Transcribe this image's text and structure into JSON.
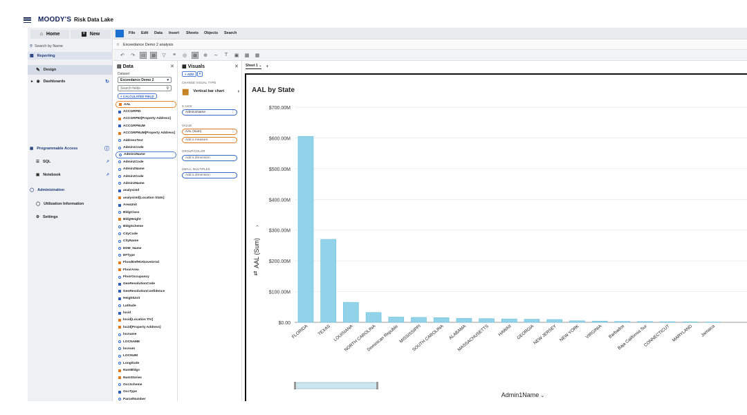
{
  "header": {
    "brand": "MOODY'S",
    "product": "Risk Data Lake"
  },
  "leftnav": {
    "home_label": "Home",
    "new_label": "New",
    "search_placeholder": "Search by Name",
    "reporting_label": "Reporting",
    "design_label": "Design",
    "dashboards_label": "Dashboards",
    "programmable_label": "Programmable Access",
    "sql_label": "SQL",
    "notebook_label": "Notebook",
    "administration_label": "Administration",
    "utilization_label": "Utilization Information",
    "settings_label": "Settings"
  },
  "appmenu": {
    "items": [
      "File",
      "Edit",
      "Data",
      "Insert",
      "Sheets",
      "Objects",
      "Search"
    ]
  },
  "analysis": {
    "name": "Exceedance Demo 2 analysis"
  },
  "datapanel": {
    "title": "Data",
    "dataset_label": "Dataset",
    "dataset_value": "Exceedance Demo 2",
    "search_placeholder": "Search fields",
    "calc_field_label": "+ CALCULATED FIELD",
    "fields": [
      {
        "name": "AAL",
        "kind": "measure",
        "selected": "orange"
      },
      {
        "name": "ACCGRPID",
        "kind": "num"
      },
      {
        "name": "ACCGRPID[Property Address]",
        "kind": "measure"
      },
      {
        "name": "ACCGRPNUM",
        "kind": "num"
      },
      {
        "name": "ACCGRPNUM[Property Address]",
        "kind": "measure"
      },
      {
        "name": "AddressText",
        "kind": "dim"
      },
      {
        "name": "Admin1Code",
        "kind": "dim"
      },
      {
        "name": "Admin1Name",
        "kind": "dim",
        "selected": "blue"
      },
      {
        "name": "Admin2Code",
        "kind": "dim"
      },
      {
        "name": "Admin2Name",
        "kind": "dim"
      },
      {
        "name": "Admin3Code",
        "kind": "dim"
      },
      {
        "name": "Admin3Name",
        "kind": "dim"
      },
      {
        "name": "analysisId",
        "kind": "num"
      },
      {
        "name": "analysisId[Location Stats]",
        "kind": "measure"
      },
      {
        "name": "AreaUnit",
        "kind": "num"
      },
      {
        "name": "BldgClass",
        "kind": "dim"
      },
      {
        "name": "BldgHeight",
        "kind": "measure"
      },
      {
        "name": "BldgScheme",
        "kind": "dim"
      },
      {
        "name": "CityCode",
        "kind": "dim"
      },
      {
        "name": "CityName",
        "kind": "dim"
      },
      {
        "name": "EDM_Name",
        "kind": "dim"
      },
      {
        "name": "EFType",
        "kind": "dim"
      },
      {
        "name": "FloodDefHtAboveGrnd",
        "kind": "measure"
      },
      {
        "name": "FloorArea",
        "kind": "measure"
      },
      {
        "name": "FloorOccupancy",
        "kind": "dim"
      },
      {
        "name": "GeoResolutionCode",
        "kind": "num"
      },
      {
        "name": "GeoResolutionConfidence",
        "kind": "num"
      },
      {
        "name": "HeightUnit",
        "kind": "num"
      },
      {
        "name": "Latitude",
        "kind": "dim"
      },
      {
        "name": "locid",
        "kind": "num"
      },
      {
        "name": "locid[Location TIV]",
        "kind": "measure"
      },
      {
        "name": "locid[Property Address]",
        "kind": "measure"
      },
      {
        "name": "locname",
        "kind": "dim"
      },
      {
        "name": "LOCNAME",
        "kind": "dim"
      },
      {
        "name": "locnum",
        "kind": "dim"
      },
      {
        "name": "LOCNUM",
        "kind": "dim"
      },
      {
        "name": "Longitude",
        "kind": "dim"
      },
      {
        "name": "NumBldgs",
        "kind": "measure"
      },
      {
        "name": "NumStories",
        "kind": "measure"
      },
      {
        "name": "OccScheme",
        "kind": "dim"
      },
      {
        "name": "OccType",
        "kind": "num"
      },
      {
        "name": "ParcelNumber",
        "kind": "dim"
      }
    ]
  },
  "visuals": {
    "title": "Visuals",
    "add_label": "+ ADD",
    "change_type_label": "CHANGE VISUAL TYPE",
    "type_label": "Vertical bar chart",
    "xaxis_label": "X AXIS",
    "xaxis_value": "Admin1Name",
    "value_label": "VALUE",
    "value_value": "AAL (Sum)",
    "add_measure": "Add a measure",
    "group_label": "GROUP/COLOR",
    "add_dimension": "Add a dimension",
    "small_multiples_label": "SMALL MULTIPLES",
    "add_dimension2": "Add a dimension"
  },
  "sheet": {
    "tab_label": "Sheet 1",
    "add_tab": "+"
  },
  "chart_data": {
    "type": "bar",
    "title": "AAL by State",
    "xlabel": "Admin1Name",
    "ylabel": "AAL (Sum)",
    "ylim": [
      0,
      700000000
    ],
    "yticks": [
      "$0.00",
      "$100.00M",
      "$200.00M",
      "$300.00M",
      "$400.00M",
      "$500.00M",
      "$600.00M",
      "$700.00M"
    ],
    "categories": [
      "FLORIDA",
      "TEXAS",
      "LOUISIANA",
      "NORTH CAROLINA",
      "Dominican Republic",
      "MISSISSIPPI",
      "SOUTH CAROLINA",
      "ALABAMA",
      "MASSACHUSETTS",
      "HAWAII",
      "GEORGIA",
      "NEW JERSEY",
      "NEW YORK",
      "VIRGINIA",
      "Barbados",
      "Baja California Sur",
      "CONNECTICUT",
      "MARYLAND",
      "Jamaica"
    ],
    "values": [
      605000000,
      270000000,
      65000000,
      32000000,
      17000000,
      16000000,
      15000000,
      13000000,
      12000000,
      11000000,
      10000000,
      9000000,
      5000000,
      4000000,
      3000000,
      2500000,
      2000000,
      1500000,
      1000000
    ],
    "bar_color": "#92d3e9",
    "bar_edge": "#6bbfdc",
    "grid": true
  }
}
